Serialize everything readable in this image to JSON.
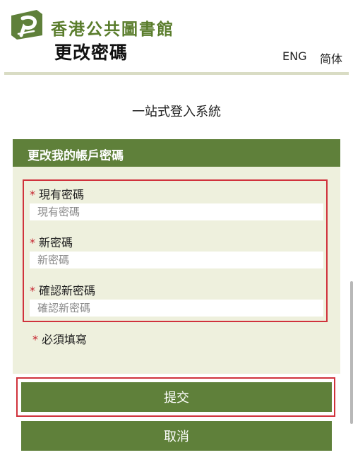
{
  "header": {
    "org_name": "香港公共圖書館",
    "page_title": "更改密碼",
    "lang_eng": "ENG",
    "lang_sc": "简体"
  },
  "subtitle": "一站式登入系統",
  "form": {
    "title": "更改我的帳戶密碼",
    "required_marker": "*",
    "fields": [
      {
        "label": "現有密碼",
        "placeholder": "現有密碼"
      },
      {
        "label": "新密碼",
        "placeholder": "新密碼"
      },
      {
        "label": "確認新密碼",
        "placeholder": "確認新密碼"
      }
    ],
    "required_note": "必須填寫"
  },
  "buttons": {
    "submit": "提交",
    "cancel": "取消"
  },
  "colors": {
    "brand_green": "#5f803a",
    "panel_bg": "#eef0dd",
    "required_red": "#c41e2a",
    "highlight_red": "#d0323c"
  }
}
